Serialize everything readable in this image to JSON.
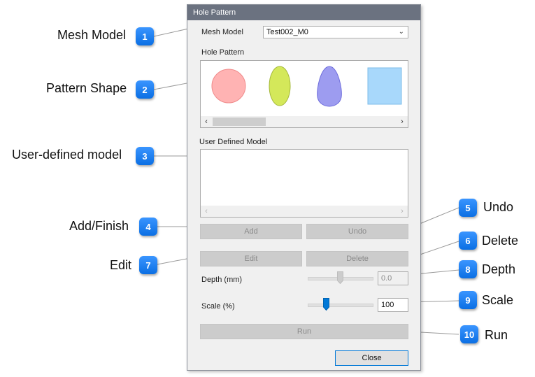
{
  "dialog": {
    "title": "Hole Pattern",
    "mesh_model_label": "Mesh Model",
    "mesh_model_value": "Test002_M0",
    "hole_pattern_label": "Hole Pattern",
    "user_defined_label": "User Defined Model",
    "add_label": "Add",
    "undo_label": "Undo",
    "edit_label": "Edit",
    "delete_label": "Delete",
    "depth_label": "Depth (mm)",
    "depth_value": "0.0",
    "depth_level": 0.5,
    "scale_label": "Scale (%)",
    "scale_value": "100",
    "scale_level": 0.27,
    "run_label": "Run",
    "close_label": "Close",
    "pattern_shapes": [
      {
        "name": "circle",
        "color": "#ffb3b3"
      },
      {
        "name": "ellipse",
        "color": "#d4e85a"
      },
      {
        "name": "egg",
        "color": "#9d9cf0"
      },
      {
        "name": "square",
        "color": "#a8d8fb"
      }
    ]
  },
  "callouts": [
    {
      "num": "1",
      "label": "Mesh Model"
    },
    {
      "num": "2",
      "label": "Pattern Shape"
    },
    {
      "num": "3",
      "label": "User-defined model"
    },
    {
      "num": "4",
      "label": "Add/Finish"
    },
    {
      "num": "5",
      "label": "Undo"
    },
    {
      "num": "6",
      "label": "Delete"
    },
    {
      "num": "7",
      "label": "Edit"
    },
    {
      "num": "8",
      "label": "Depth"
    },
    {
      "num": "9",
      "label": "Scale"
    },
    {
      "num": "10",
      "label": "Run"
    }
  ],
  "colors": {
    "badge": "#1a7ff0",
    "titlebar": "#6b7280",
    "accent": "#0078d7"
  }
}
